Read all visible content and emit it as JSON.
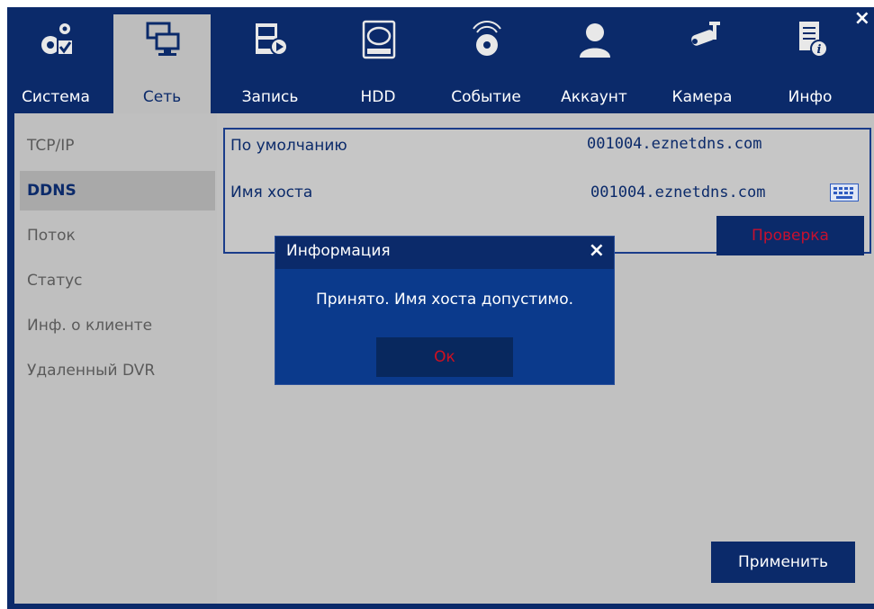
{
  "nav": {
    "tabs": [
      {
        "label": "Система",
        "icon": "gears-check-icon"
      },
      {
        "label": "Сеть",
        "icon": "network-monitors-icon"
      },
      {
        "label": "Запись",
        "icon": "film-record-icon"
      },
      {
        "label": "HDD",
        "icon": "hdd-icon"
      },
      {
        "label": "Событие",
        "icon": "alarm-bell-icon"
      },
      {
        "label": "Аккаунт",
        "icon": "user-account-icon"
      },
      {
        "label": "Камера",
        "icon": "security-camera-icon"
      },
      {
        "label": "Инфо",
        "icon": "info-document-icon"
      }
    ],
    "active_tab": "Сеть",
    "close_glyph": "×"
  },
  "sidebar": {
    "items": [
      {
        "label": "TCP/IP"
      },
      {
        "label": "DDNS"
      },
      {
        "label": "Поток"
      },
      {
        "label": "Статус"
      },
      {
        "label": "Инф. о клиенте"
      },
      {
        "label": "Удаленный DVR"
      }
    ],
    "active_item": "DDNS"
  },
  "ddns": {
    "default_label": "По умолчанию",
    "default_value": "001004.eznetdns.com",
    "hostname_label": "Имя хоста",
    "hostname_value": "001004.eznetdns.com",
    "check_button": "Проверка"
  },
  "dialog": {
    "title": "Информация",
    "close_glyph": "×",
    "message": "Принято. Имя хоста допустимо.",
    "ok_button": "Ок"
  },
  "footer": {
    "apply_button": "Применить"
  },
  "colors": {
    "primary": "#0b2a6a",
    "panel_bg": "#c1c1c1",
    "accent_red": "#c8102e"
  }
}
